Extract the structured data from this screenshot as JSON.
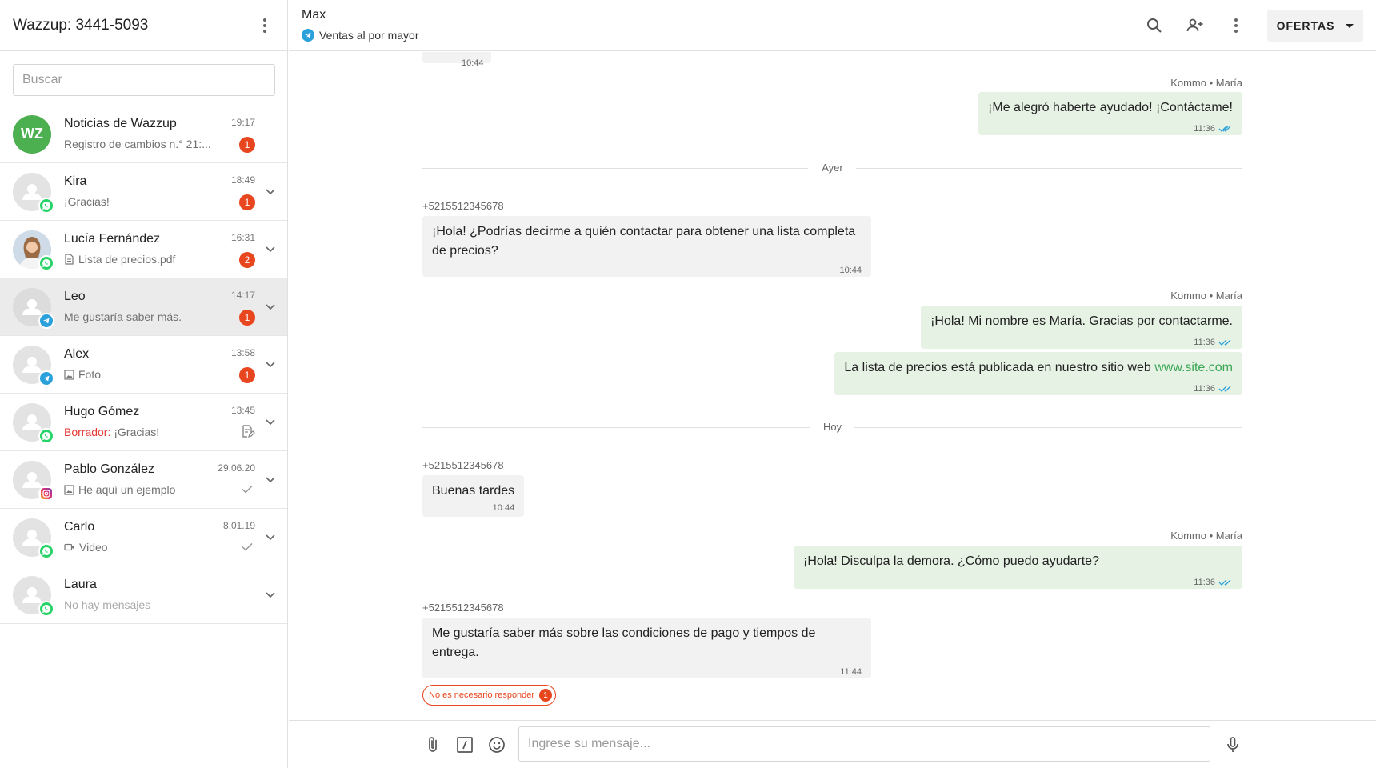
{
  "sidebar": {
    "title": "Wazzup: 3441-5093",
    "search_placeholder": "Buscar",
    "chats": [
      {
        "name": "Noticias de Wazzup",
        "preview": "Registro de cambios n.° 21:...",
        "time": "19:17",
        "unread": "1",
        "avatar": "WZ"
      },
      {
        "name": "Kira",
        "preview": "¡Gracias!",
        "time": "18:49",
        "unread": "1",
        "source": "whatsapp"
      },
      {
        "name": "Lucía Fernández",
        "preview": "Lista de precios.pdf",
        "time": "16:31",
        "unread": "2",
        "source": "whatsapp",
        "preview_icon": "document-icon"
      },
      {
        "name": "Leo",
        "preview": "Me gustaría saber más.",
        "time": "14:17",
        "unread": "1",
        "source": "telegram"
      },
      {
        "name": "Alex",
        "preview": "Foto",
        "time": "13:58",
        "unread": "1",
        "source": "telegram",
        "preview_icon": "image-icon"
      },
      {
        "name": "Hugo Gómez",
        "draft_label": "Borrador:",
        "preview": "¡Gracias!",
        "time": "13:45",
        "source": "whatsapp",
        "status_icon": "draft-icon"
      },
      {
        "name": "Pablo González",
        "preview": "He aquí un ejemplo",
        "time": "29.06.20",
        "source": "instagram",
        "preview_icon": "image-icon",
        "status_icon": "check-icon"
      },
      {
        "name": "Carlo",
        "preview": "Video",
        "time": "8.01.19",
        "source": "whatsapp",
        "preview_icon": "video-icon",
        "status_icon": "check-icon"
      },
      {
        "name": "Laura",
        "preview": "No hay mensajes",
        "time": "",
        "source": "whatsapp"
      }
    ]
  },
  "header": {
    "contact_name": "Max",
    "channel": "Ventas al por mayor",
    "offers_label": "OFERTAS"
  },
  "messages": {
    "top_time": "10:44",
    "m1": {
      "sender": "Kommo • María",
      "text": "¡Me alegró haberte ayudado! ¡Contáctame!",
      "time": "11:36"
    },
    "divider_yesterday": "Ayer",
    "m2": {
      "sender": "+5215512345678",
      "text": "¡Hola! ¿Podrías decirme a quién contactar para obtener una lista completa de precios?",
      "time": "10:44"
    },
    "m3": {
      "sender": "Kommo • María",
      "text": "¡Hola! Mi nombre es María. Gracias por contactarme.",
      "time": "11:36"
    },
    "m4": {
      "text": "La lista de precios está publicada en nuestro sitio web ",
      "link": "www.site.com",
      "time": "11:36"
    },
    "divider_today": "Hoy",
    "m5": {
      "sender": "+5215512345678",
      "text": "Buenas tardes",
      "time": "10:44"
    },
    "m6": {
      "sender": "Kommo • María",
      "text": "¡Hola! Disculpa la demora. ¿Cómo puedo ayudarte?",
      "time": "11:36"
    },
    "m7": {
      "sender": "+5215512345678",
      "text": "Me gustaría saber más sobre las condiciones de pago y tiempos de entrega.",
      "time": "11:44"
    },
    "no_reply": {
      "label": "No es necesario responder",
      "count": "1"
    }
  },
  "composer": {
    "placeholder": "Ingrese su mensaje..."
  },
  "colors": {
    "accent_green": "#4caf50",
    "outgoing_bubble": "#e6f2e4",
    "incoming_bubble": "#f2f2f2",
    "unread_badge": "#e8461e",
    "read_tick": "#2aa1da",
    "link": "#3aa655"
  }
}
